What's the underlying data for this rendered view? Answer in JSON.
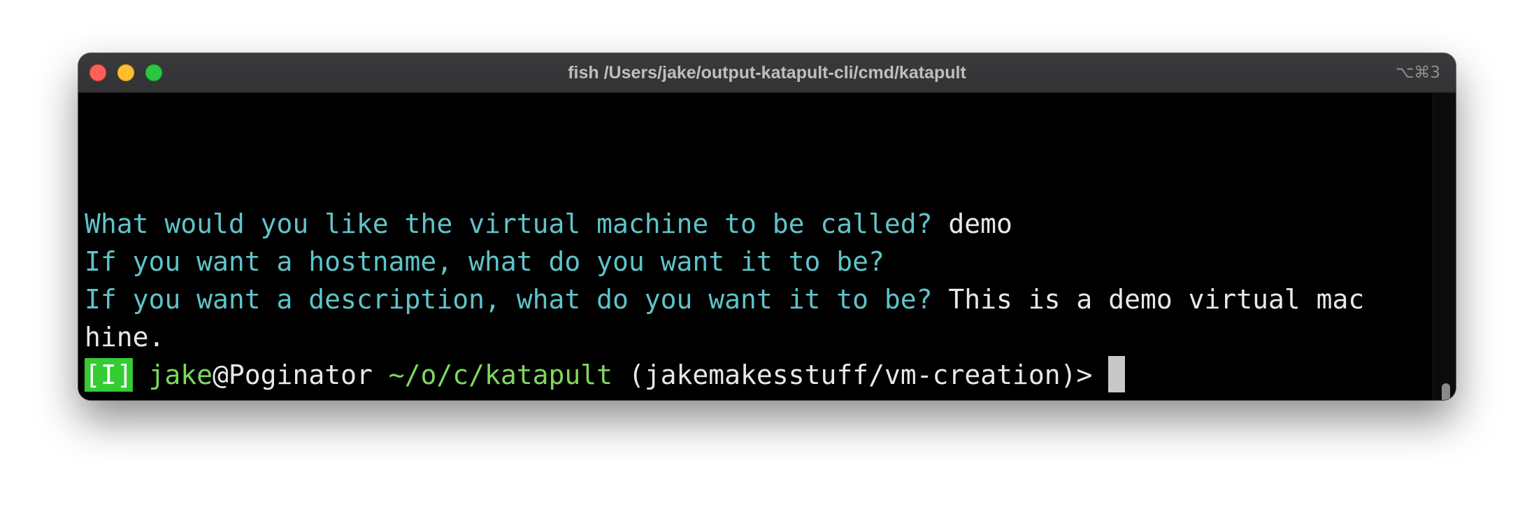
{
  "window": {
    "title": "fish /Users/jake/output-katapult-cli/cmd/katapult",
    "shortcut": "⌥⌘3"
  },
  "terminal": {
    "line1": {
      "prompt": "What would you like the virtual machine to be called?",
      "answer": " demo"
    },
    "line2": {
      "prompt": "If you want a hostname, what do you want it to be?"
    },
    "line3": {
      "prompt": "If you want a description, what do you want it to be?",
      "answer": " This is a demo virtual mac"
    },
    "line4": {
      "text": "hine."
    },
    "prompt_line": {
      "mode_badge": "[I]",
      "user": "jake",
      "at_host": "@Poginator",
      "cwd": "~/o/c/katapult",
      "branch": "(jakemakesstuff/vm-creation)>"
    }
  },
  "colors": {
    "prompt_text": "#5ec4c9",
    "answer_text": "#e8e8e8",
    "green": "#7ed860",
    "mode_badge_bg": "#33cc33",
    "background": "#000000"
  }
}
